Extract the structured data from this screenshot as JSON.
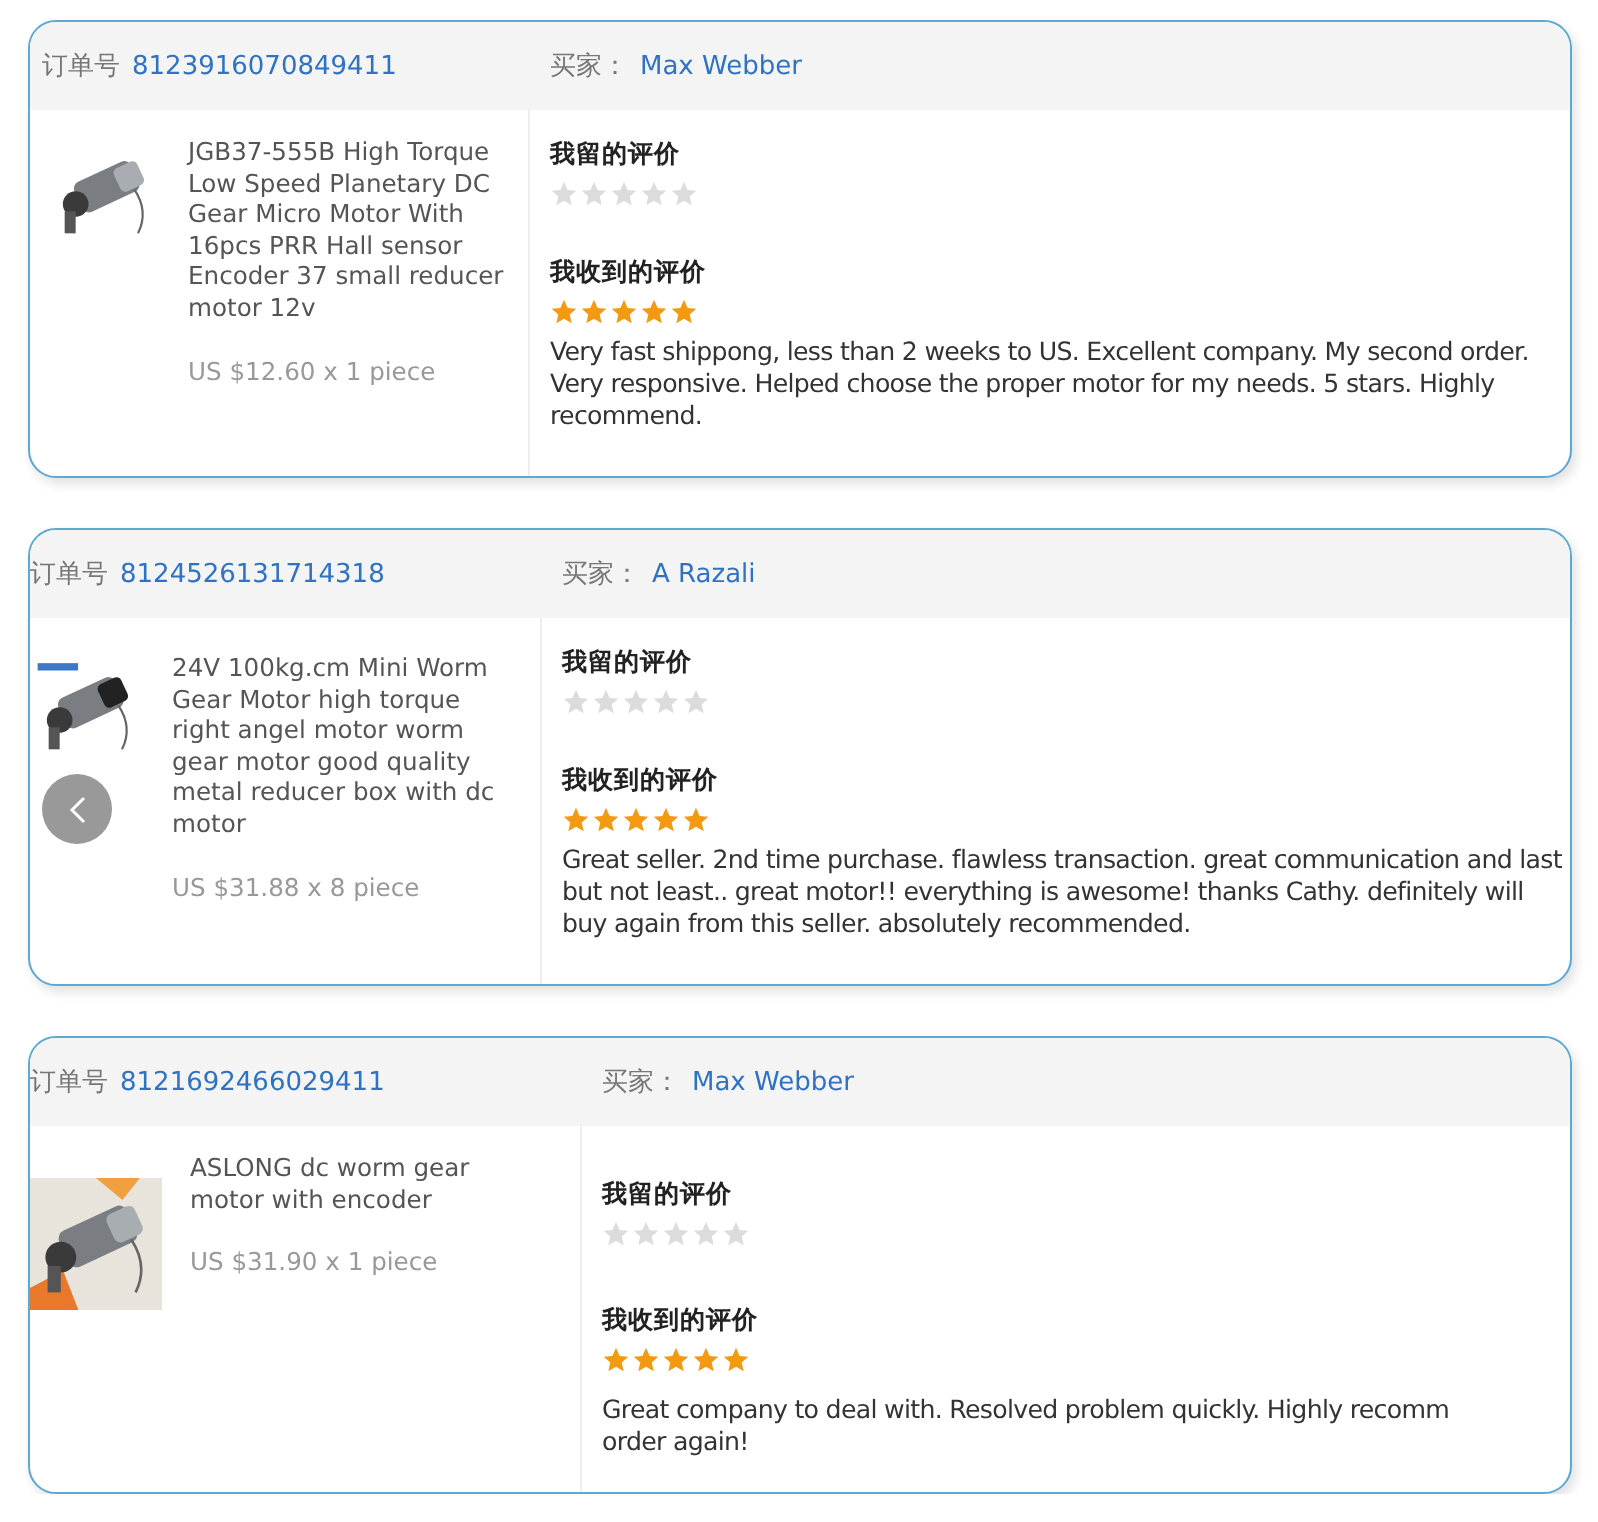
{
  "orders": [
    {
      "order_label": "订单号",
      "order_number": "8123916070849411",
      "buyer_label": "买家：",
      "buyer_name": "Max Webber",
      "product": {
        "image": {
          "kind": "picture"
        },
        "title_lines": [
          "JGB37-555B High Torque",
          "Low Speed Planetary DC",
          "Gear Micro Motor With",
          "16pcs PRR Hall sensor",
          "Encoder 37 small reducer",
          "motor 12v"
        ],
        "price": "US $12.60 x 1 piece"
      },
      "my_review": {
        "heading": "我留的评价",
        "stars": 0
      },
      "received_review": {
        "heading": "我收到的评价",
        "stars": 5,
        "text_lines": [
          "Very fast shippong, less than 2 weeks to US. Excellent company. My second order.",
          "Very responsive. Helped choose the proper motor for my needs. 5 stars. Highly",
          "recommend."
        ]
      }
    },
    {
      "order_label": "订单号",
      "order_number": "8124526131714318",
      "buyer_label": "买家：",
      "buyer_name": "A Razali",
      "product": {
        "image": {
          "kind": "picture"
        },
        "carousel_prev": true,
        "title_lines": [
          "24V 100kg.cm Mini Worm",
          "Gear Motor high torque",
          "right angel motor worm",
          "gear motor good quality",
          "metal reducer box with dc",
          "motor"
        ],
        "price": "US $31.88 x 8 piece"
      },
      "my_review": {
        "heading": "我留的评价",
        "stars": 0
      },
      "received_review": {
        "heading": "我收到的评价",
        "stars": 5,
        "text_lines": [
          "Great seller. 2nd time purchase. flawless transaction. great communication and last",
          "but not least.. great motor!! everything is awesome! thanks Cathy. definitely will",
          "buy again from this seller. absolutely recommended."
        ]
      }
    },
    {
      "order_label": "订单号",
      "order_number": "8121692466029411",
      "buyer_label": "买家：",
      "buyer_name": "Max Webber",
      "product": {
        "image": {
          "kind": "picture"
        },
        "title_lines": [
          "ASLONG dc worm gear",
          "motor with encoder"
        ],
        "price": "US $31.90 x 1 piece"
      },
      "my_review": {
        "heading": "我留的评价",
        "stars": 0
      },
      "received_review": {
        "heading": "我收到的评价",
        "stars": 5,
        "text_lines": [
          "Great company to deal with. Resolved problem quickly. Highly recomm",
          "order again!"
        ]
      }
    }
  ]
}
